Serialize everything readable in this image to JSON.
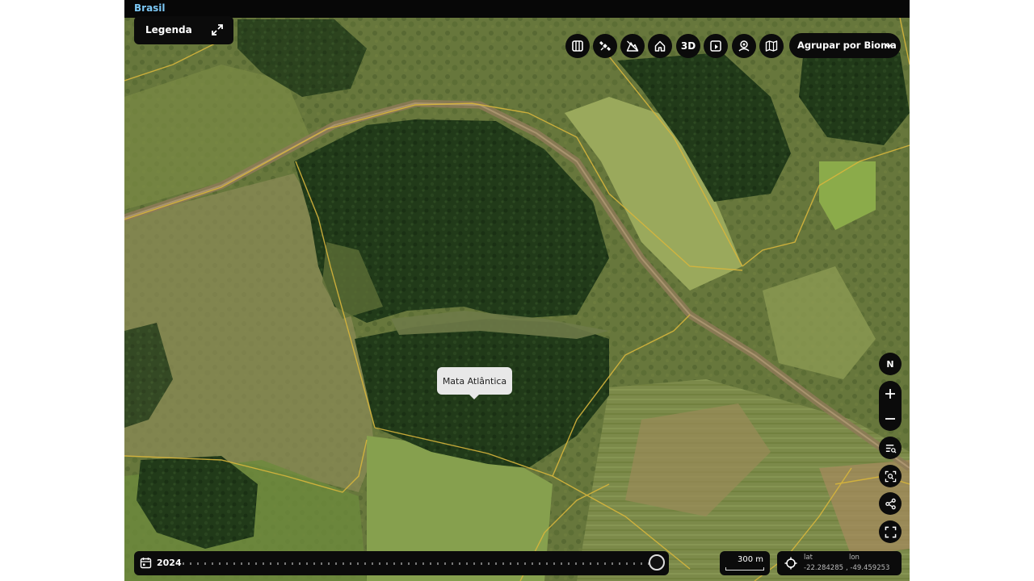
{
  "header": {
    "title": "Brasil"
  },
  "legend": {
    "label": "Legenda"
  },
  "toolbar": {
    "buttons": [
      {
        "name": "compare-icon"
      },
      {
        "name": "satellite-icon"
      },
      {
        "name": "terrain-icon"
      },
      {
        "name": "home-icon"
      },
      {
        "name": "3d-button",
        "text": "3D"
      },
      {
        "name": "media-icon"
      },
      {
        "name": "user-location-icon"
      },
      {
        "name": "map-icon"
      }
    ],
    "group_label": "Agrupar por Bioma"
  },
  "map": {
    "feature_label": "Mata Atlântica",
    "compass_label": "N"
  },
  "timeline": {
    "year": "2024"
  },
  "scale": {
    "value": "300 m"
  },
  "coords": {
    "lat_label": "lat",
    "lat_value": "-22.284285",
    "lon_label": "lon",
    "lon_value": "-49.459253"
  },
  "colors": {
    "panel": "#0b0b0b",
    "header_link": "#7cc8f5",
    "boundary": "#d8b63c",
    "forest": "#1f3517"
  }
}
